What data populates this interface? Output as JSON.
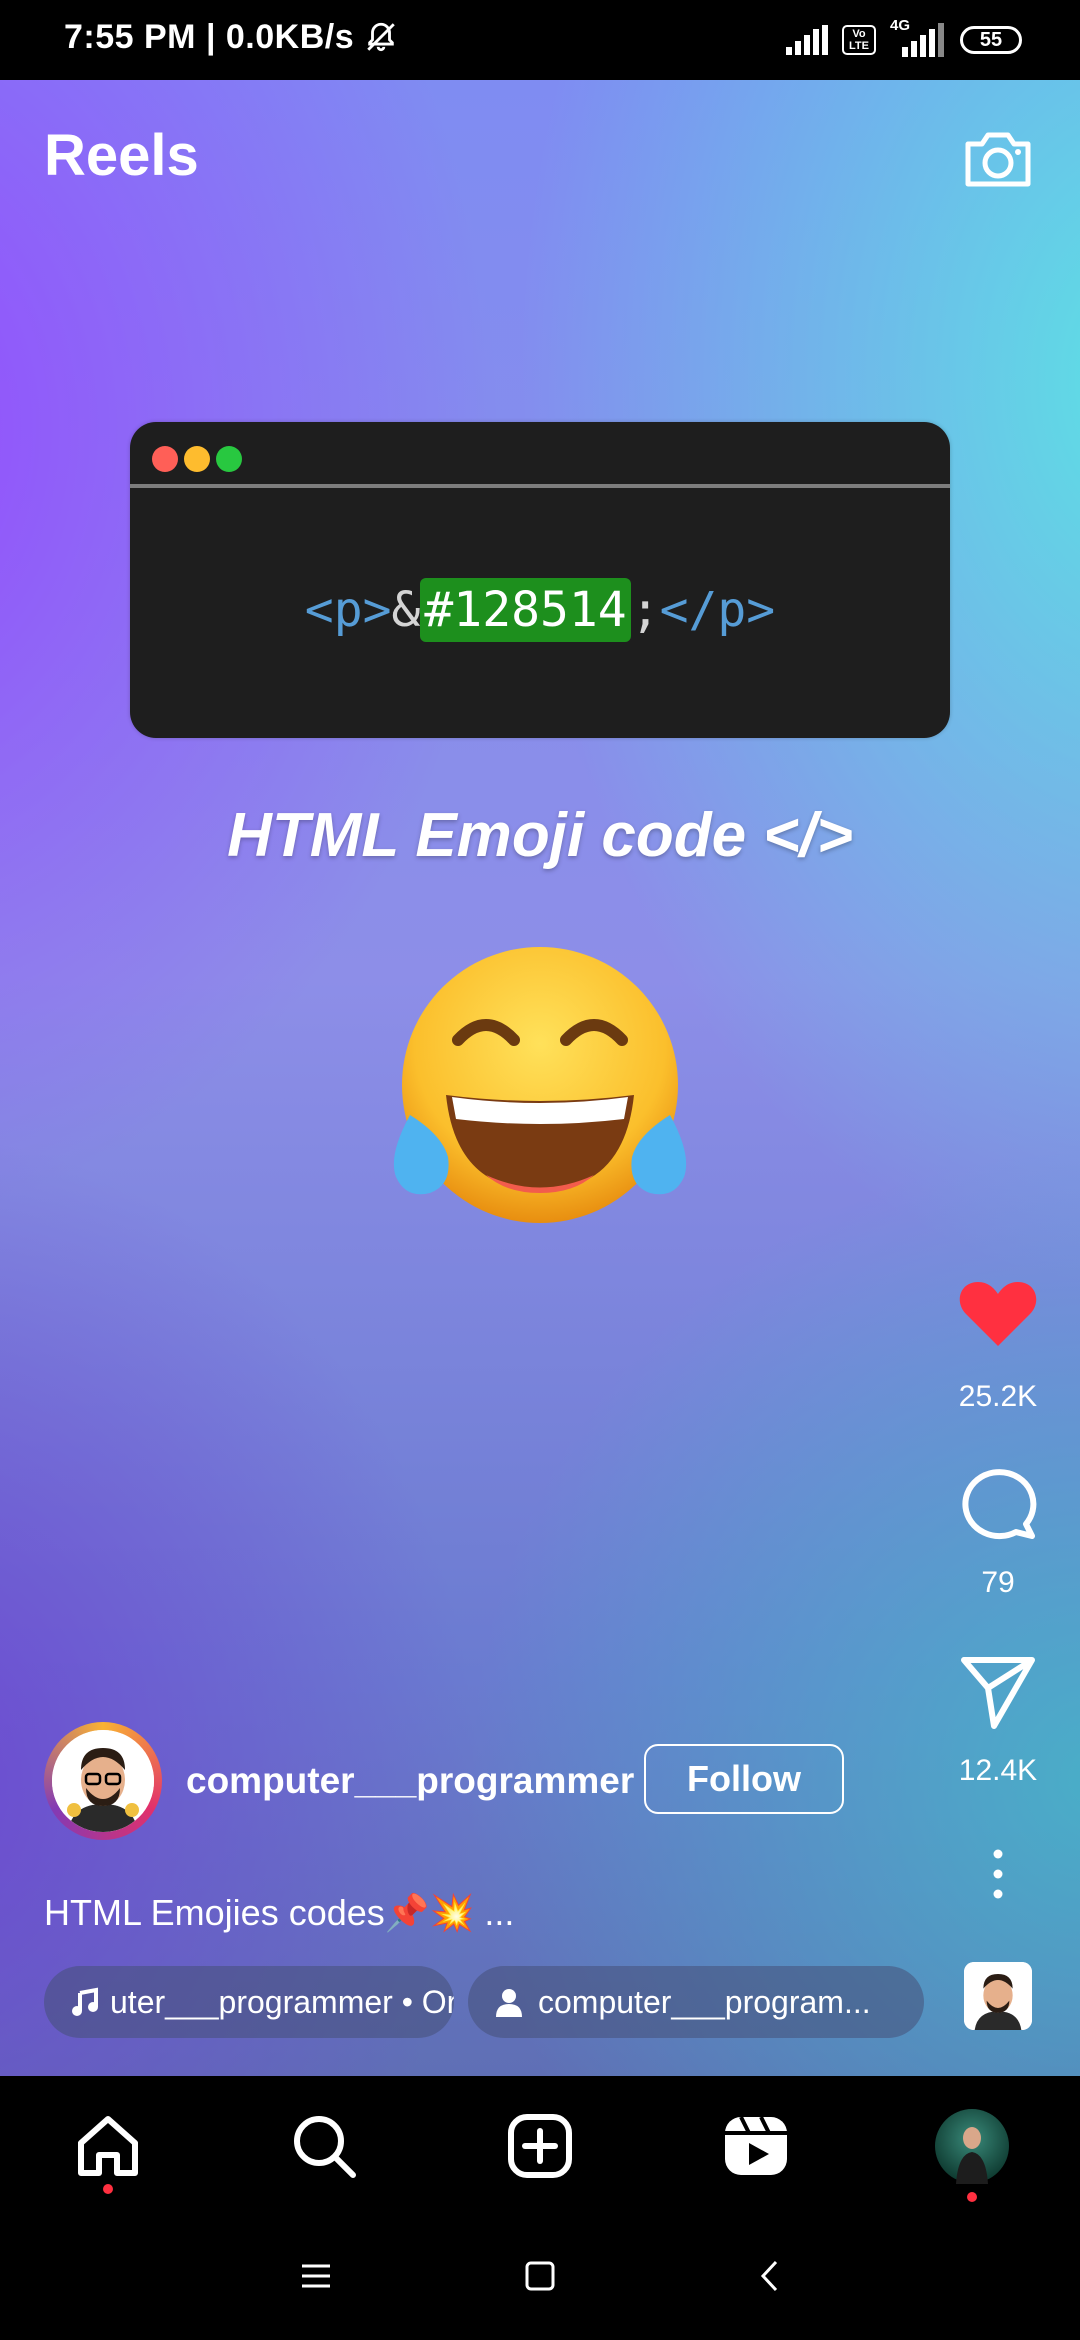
{
  "status": {
    "time": "7:55 PM | 0.0KB/s",
    "network_type": "4G",
    "volte": "Vo LTE",
    "battery": "55"
  },
  "header": {
    "title": "Reels",
    "camera_icon": "camera-icon"
  },
  "video": {
    "code_open_tag": "<p>",
    "code_amp": "&",
    "code_highlight": "#128514",
    "code_semicolon": ";",
    "code_close_tag": "</p>",
    "headline": "HTML Emoji code </>",
    "emoji_icon": "face-with-tears-of-joy-icon"
  },
  "actions": {
    "likes": "25.2K",
    "comments": "79",
    "shares": "12.4K"
  },
  "post": {
    "username": "computer___programmer",
    "follow_label": "Follow",
    "caption": "HTML Emojies codes📌💥  ...",
    "audio_chip": "uter___programmer • Original audio",
    "person_chip": "computer___program..."
  },
  "colors": {
    "like": "#ff3040",
    "highlight": "#1d8f1d",
    "notification_dot": "#ff3040"
  }
}
